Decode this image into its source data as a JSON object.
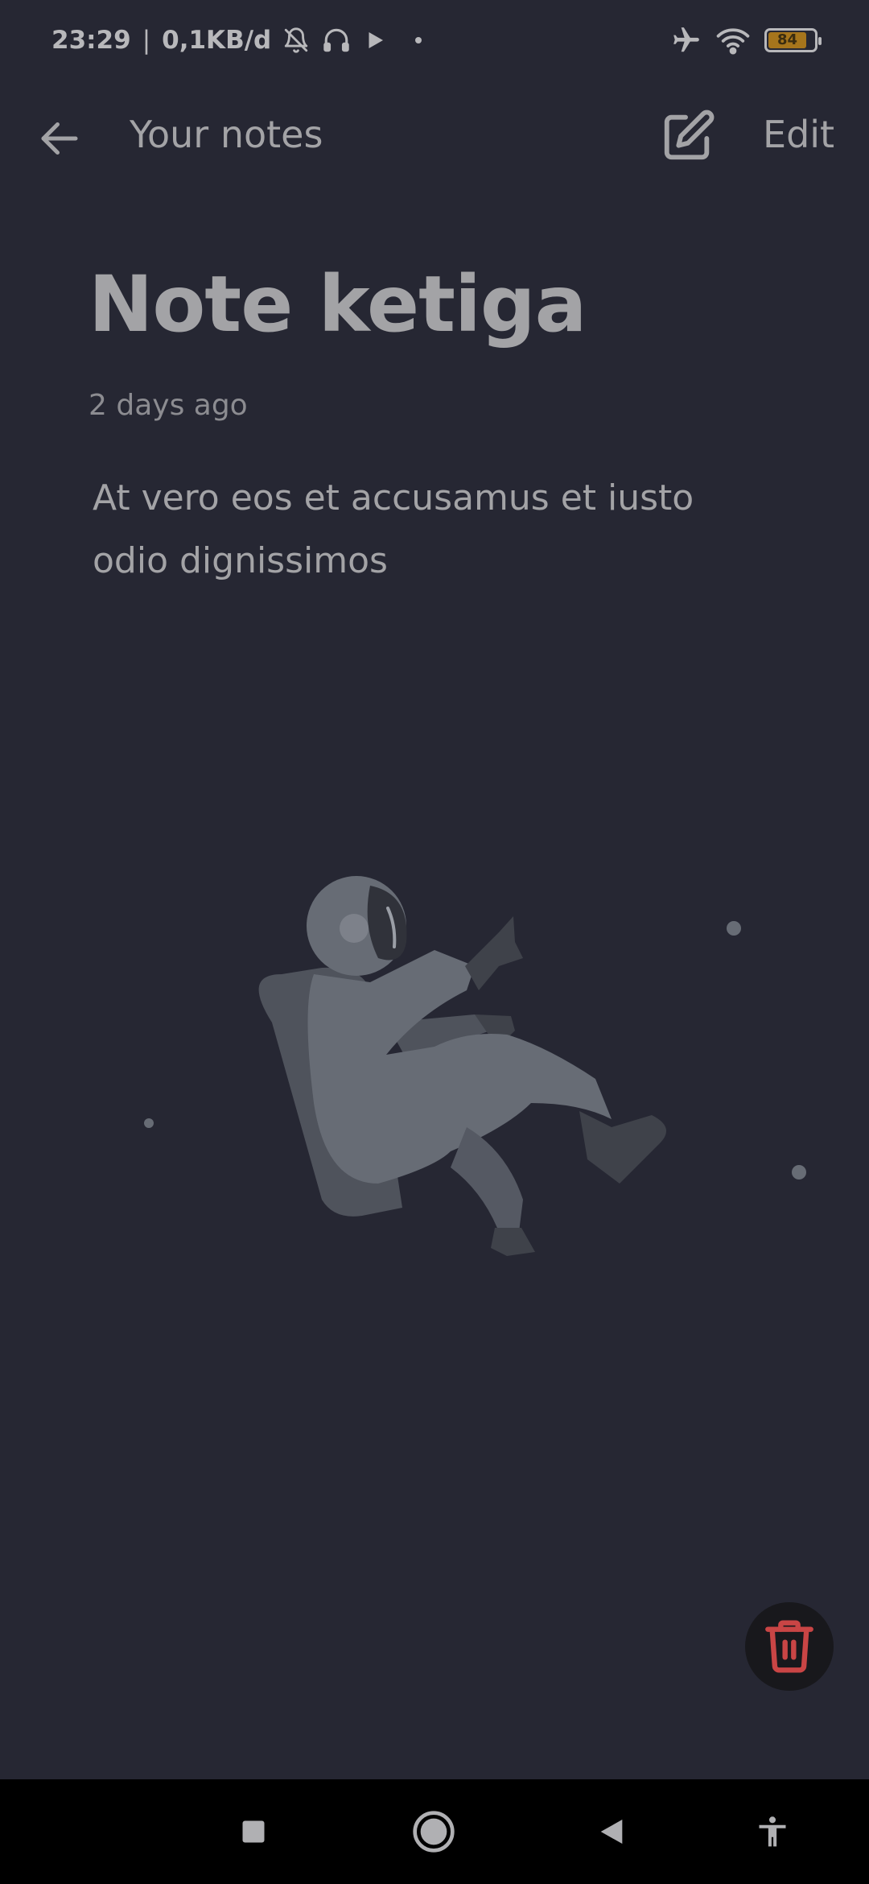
{
  "status_bar": {
    "time": "23:29",
    "network_speed": "0,1KB/d",
    "battery_level": "84",
    "icons": [
      "mute-bell-icon",
      "headphones-icon",
      "play-icon",
      "dot-icon",
      "airplane-icon",
      "wifi-icon",
      "battery-icon"
    ]
  },
  "app_bar": {
    "title": "Your notes",
    "edit_label": "Edit",
    "icons": [
      "back-arrow-icon",
      "edit-square-icon"
    ]
  },
  "note": {
    "title": "Note ketiga",
    "date": "2 days ago",
    "body": "At vero eos et accusamus et iusto odio dignissimos"
  },
  "fab": {
    "icon": "trash-icon",
    "color": "#c94545"
  },
  "navigation_bar": {
    "icons": [
      "recents-square-icon",
      "home-circle-icon",
      "back-triangle-icon",
      "accessibility-icon"
    ]
  },
  "colors": {
    "background": "#262733",
    "text": "#a3a3a6",
    "illustration": "#676c75"
  }
}
